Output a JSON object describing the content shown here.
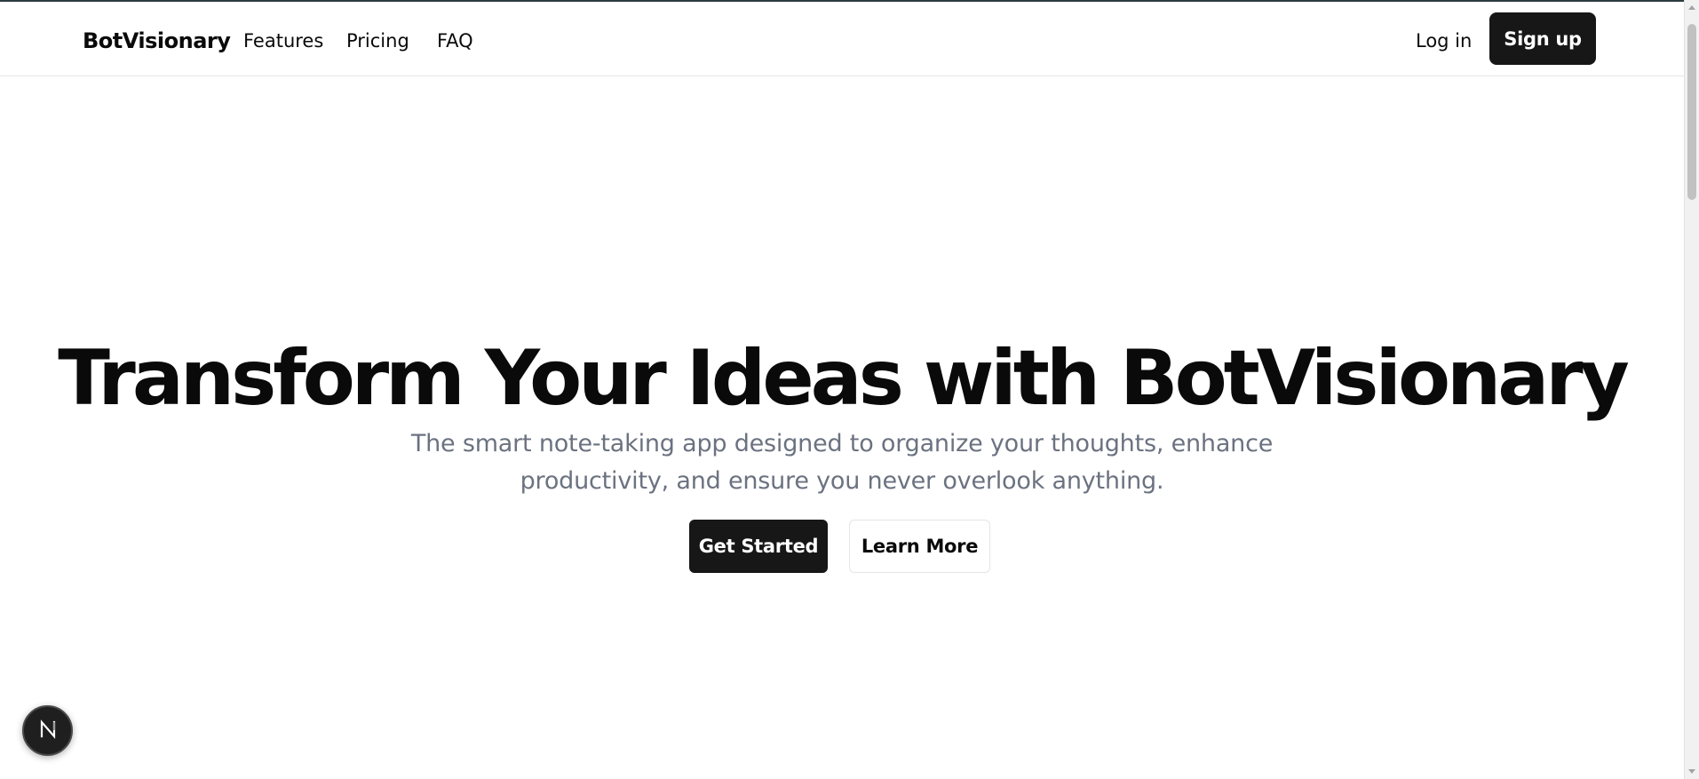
{
  "header": {
    "brand": "BotVisionary",
    "nav": {
      "features": "Features",
      "pricing": "Pricing",
      "faq": "FAQ"
    },
    "login_label": "Log in",
    "signup_label": "Sign up"
  },
  "hero": {
    "title": "Transform Your Ideas with BotVisionary",
    "subtitle_line1": "The smart note-taking app designed to organize your thoughts, enhance",
    "subtitle_line2": "productivity, and ensure you never overlook anything.",
    "primary_cta": "Get Started",
    "secondary_cta": "Learn More"
  },
  "badge": {
    "icon": "nextjs-n-icon"
  },
  "colors": {
    "primary_button": "#171717",
    "subtitle_text": "#6b7280",
    "background": "#ffffff"
  }
}
